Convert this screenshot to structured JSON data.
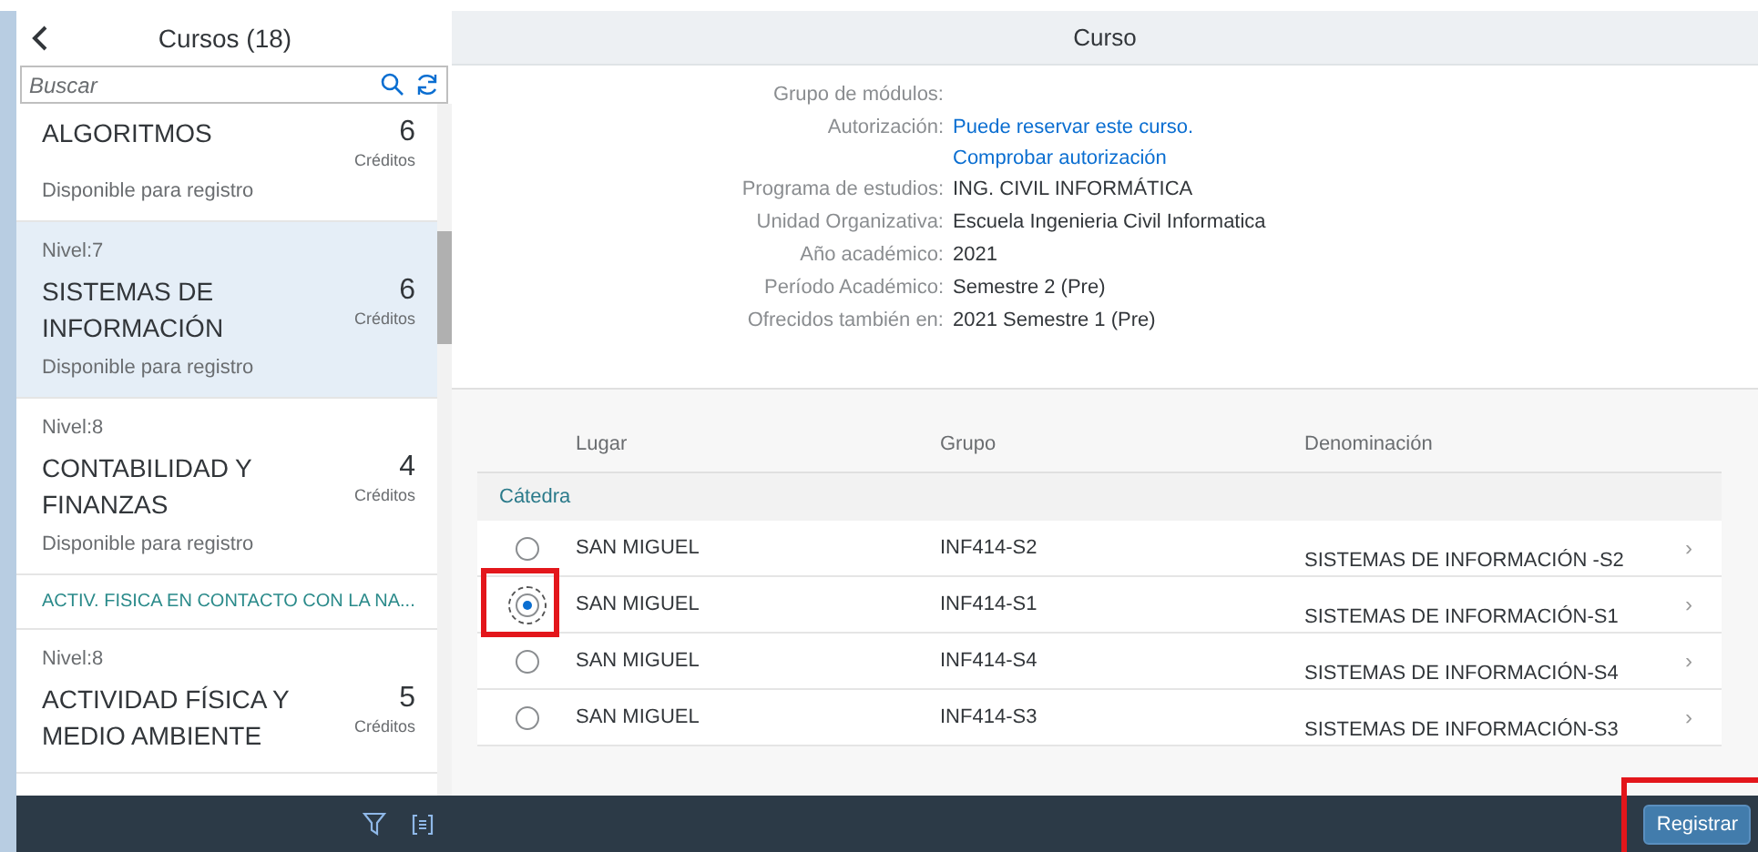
{
  "list": {
    "title": "Cursos (18)",
    "search": {
      "placeholder": "Buscar"
    },
    "items": [
      {
        "kind": "course",
        "title": "ALGORITMOS",
        "credits": "6",
        "credits_label": "Créditos",
        "status": "Disponible para registro",
        "selected": false
      },
      {
        "kind": "course",
        "level": "Nivel:7",
        "title": "SISTEMAS DE INFORMACIÓN",
        "credits": "6",
        "credits_label": "Créditos",
        "status": "Disponible para registro",
        "selected": true
      },
      {
        "kind": "course",
        "level": "Nivel:8",
        "title": "CONTABILIDAD Y FINANZAS",
        "credits": "4",
        "credits_label": "Créditos",
        "status": "Disponible para registro",
        "selected": false
      },
      {
        "kind": "group",
        "title": "ACTIV. FISICA EN CONTACTO CON LA NA..."
      },
      {
        "kind": "course",
        "level": "Nivel:8",
        "title": "ACTIVIDAD FÍSICA Y MEDIO AMBIENTE",
        "credits": "5",
        "credits_label": "Créditos",
        "selected": false
      }
    ]
  },
  "detail": {
    "title": "Curso",
    "fields": [
      {
        "label": "Grupo de módulos:"
      },
      {
        "label": "Autorización:",
        "values": [
          {
            "text": "Puede reservar este curso.",
            "kind": "link"
          },
          {
            "text": "Comprobar autorización",
            "kind": "link"
          }
        ]
      },
      {
        "label": "Programa de estudios:",
        "values": [
          {
            "text": "ING. CIVIL INFORMÁTICA",
            "kind": "text"
          }
        ]
      },
      {
        "label": "Unidad Organizativa:",
        "values": [
          {
            "text": "Escuela Ingenieria Civil Informatica",
            "kind": "text"
          }
        ]
      },
      {
        "label": "Año académico:",
        "values": [
          {
            "text": "2021",
            "kind": "text"
          }
        ]
      },
      {
        "label": "Período Académico:",
        "values": [
          {
            "text": "Semestre 2 (Pre)",
            "kind": "text"
          }
        ]
      },
      {
        "label": "Ofrecidos también en:",
        "values": [
          {
            "text": "2021 Semestre 1 (Pre)",
            "kind": "text"
          }
        ]
      }
    ],
    "table": {
      "columns": [
        "Lugar",
        "Grupo",
        "Denominación"
      ],
      "group": "Cátedra",
      "rows": [
        {
          "place": "SAN MIGUEL",
          "group": "INF414-S2",
          "name": "SISTEMAS DE INFORMACIÓN -S2",
          "chevron": "›",
          "selected": false,
          "highlighted": false
        },
        {
          "place": "SAN MIGUEL",
          "group": "INF414-S1",
          "name": "SISTEMAS DE INFORMACIÓN-S1",
          "chevron": "›",
          "selected": true,
          "highlighted": true
        },
        {
          "place": "SAN MIGUEL",
          "group": "INF414-S4",
          "name": "SISTEMAS DE INFORMACIÓN-S4",
          "chevron": "›",
          "selected": false,
          "highlighted": false
        },
        {
          "place": "SAN MIGUEL",
          "group": "INF414-S3",
          "name": "SISTEMAS DE INFORMACIÓN-S3",
          "chevron": "›",
          "selected": false,
          "highlighted": false
        }
      ]
    },
    "register_button": {
      "label": "Registrar",
      "highlighted": true
    }
  }
}
